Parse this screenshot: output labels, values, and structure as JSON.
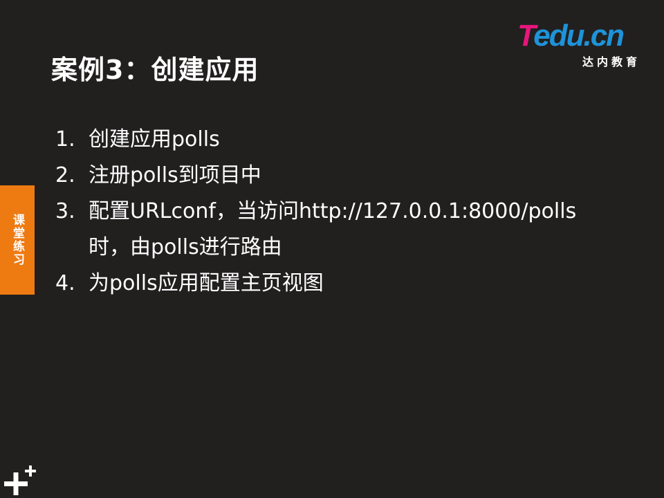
{
  "slide": {
    "title": "案例3：创建应用",
    "logo": {
      "brand_t": "T",
      "brand_rest": "edu.cn",
      "subtitle": "达内教育"
    },
    "side_tab": "课堂练习",
    "items": [
      {
        "num": "1.",
        "lines": [
          "创建应用polls"
        ]
      },
      {
        "num": "2.",
        "lines": [
          "注册polls到项目中"
        ]
      },
      {
        "num": "3.",
        "lines": [
          "配置URLconf，当访问http://127.0.0.1:8000/polls",
          "时，由polls进行路由"
        ]
      },
      {
        "num": "4.",
        "lines": [
          "为polls应用配置主页视图"
        ]
      }
    ]
  },
  "colors": {
    "background": "#221f1f",
    "tab": "#ee7a12",
    "logo_pink": "#e5177b",
    "logo_blue": "#1e93d8",
    "text": "#ffffff"
  },
  "icons": {
    "corner": "plus-icon"
  }
}
